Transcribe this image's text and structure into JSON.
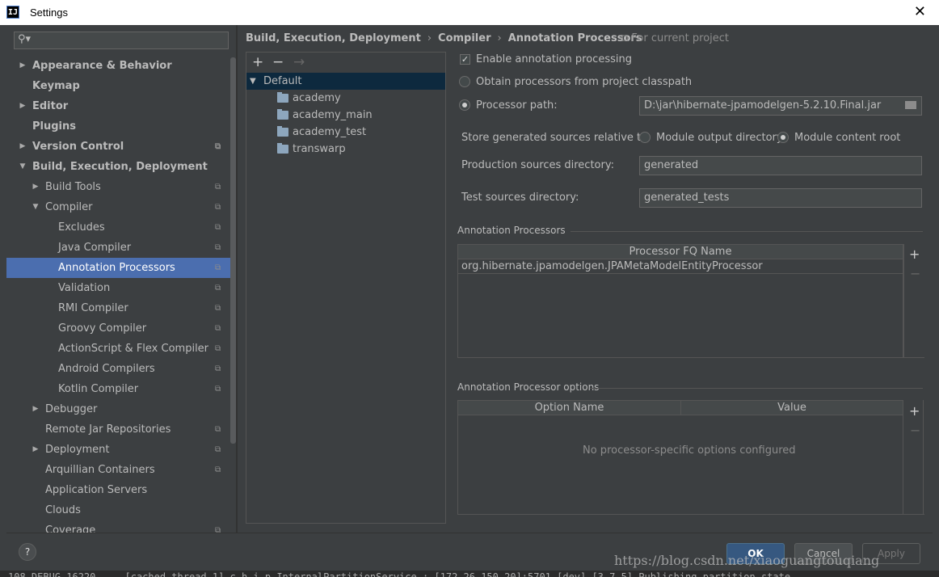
{
  "window": {
    "title": "Settings",
    "app_icon": "IJ"
  },
  "search": {
    "placeholder": ""
  },
  "tree": [
    {
      "label": "Appearance & Behavior",
      "bold": true,
      "arrow": "right",
      "indent": 0
    },
    {
      "label": "Keymap",
      "bold": true,
      "arrow": "",
      "indent": 0
    },
    {
      "label": "Editor",
      "bold": true,
      "arrow": "right",
      "indent": 0
    },
    {
      "label": "Plugins",
      "bold": true,
      "arrow": "",
      "indent": 0
    },
    {
      "label": "Version Control",
      "bold": true,
      "arrow": "right",
      "indent": 0,
      "project": true
    },
    {
      "label": "Build, Execution, Deployment",
      "bold": true,
      "arrow": "down",
      "indent": 0
    },
    {
      "label": "Build Tools",
      "bold": false,
      "arrow": "right",
      "indent": 1,
      "project": true
    },
    {
      "label": "Compiler",
      "bold": false,
      "arrow": "down",
      "indent": 1,
      "project": true
    },
    {
      "label": "Excludes",
      "bold": false,
      "arrow": "",
      "indent": 2,
      "project": true
    },
    {
      "label": "Java Compiler",
      "bold": false,
      "arrow": "",
      "indent": 2,
      "project": true
    },
    {
      "label": "Annotation Processors",
      "bold": false,
      "arrow": "",
      "indent": 2,
      "project": true,
      "selected": true
    },
    {
      "label": "Validation",
      "bold": false,
      "arrow": "",
      "indent": 2,
      "project": true
    },
    {
      "label": "RMI Compiler",
      "bold": false,
      "arrow": "",
      "indent": 2,
      "project": true
    },
    {
      "label": "Groovy Compiler",
      "bold": false,
      "arrow": "",
      "indent": 2,
      "project": true
    },
    {
      "label": "ActionScript & Flex Compiler",
      "bold": false,
      "arrow": "",
      "indent": 2,
      "project": true
    },
    {
      "label": "Android Compilers",
      "bold": false,
      "arrow": "",
      "indent": 2,
      "project": true
    },
    {
      "label": "Kotlin Compiler",
      "bold": false,
      "arrow": "",
      "indent": 2,
      "project": true
    },
    {
      "label": "Debugger",
      "bold": false,
      "arrow": "right",
      "indent": 1
    },
    {
      "label": "Remote Jar Repositories",
      "bold": false,
      "arrow": "",
      "indent": 1,
      "project": true
    },
    {
      "label": "Deployment",
      "bold": false,
      "arrow": "right",
      "indent": 1,
      "project": true
    },
    {
      "label": "Arquillian Containers",
      "bold": false,
      "arrow": "",
      "indent": 1,
      "project": true
    },
    {
      "label": "Application Servers",
      "bold": false,
      "arrow": "",
      "indent": 1
    },
    {
      "label": "Clouds",
      "bold": false,
      "arrow": "",
      "indent": 1
    },
    {
      "label": "Coverage",
      "bold": false,
      "arrow": "",
      "indent": 1,
      "project": true
    }
  ],
  "breadcrumb": [
    "Build, Execution, Deployment",
    "Compiler",
    "Annotation Processors"
  ],
  "for_current_project": "For current project",
  "profiles": {
    "toolbar": {
      "add": "+",
      "remove": "−",
      "move": "→"
    },
    "root": "Default",
    "modules": [
      "academy",
      "academy_main",
      "academy_test",
      "transwarp"
    ]
  },
  "options": {
    "enable_label": "Enable annotation processing",
    "enable_checked": true,
    "obtain_label": "Obtain processors from project classpath",
    "path_label": "Processor path:",
    "path_value": "D:\\jar\\hibernate-jpamodelgen-5.2.10.Final.jar",
    "store_label": "Store generated sources relative to:",
    "module_output_label": "Module output directory",
    "module_content_label": "Module content root",
    "prod_label": "Production sources directory:",
    "prod_value": "generated",
    "test_label": "Test sources directory:",
    "test_value": "generated_tests"
  },
  "processors": {
    "section": "Annotation Processors",
    "column": "Processor FQ Name",
    "rows": [
      "org.hibernate.jpamodelgen.JPAMetaModelEntityProcessor"
    ]
  },
  "processor_options": {
    "section": "Annotation Processor options",
    "col_name": "Option Name",
    "col_value": "Value",
    "empty": "No processor-specific options configured"
  },
  "footer": {
    "help": "?",
    "ok": "OK",
    "cancel": "Cancel",
    "apply": "Apply"
  },
  "watermark": "https://blog.csdn.net/xiaoguangtouqiang",
  "console_text": "108 DEBUG 16220 --- [cached thread 1] c.h.i.p.InternalPartitionService : [172.26.150.20]:5701 [dev] [3.7.5] Publishing partition state"
}
